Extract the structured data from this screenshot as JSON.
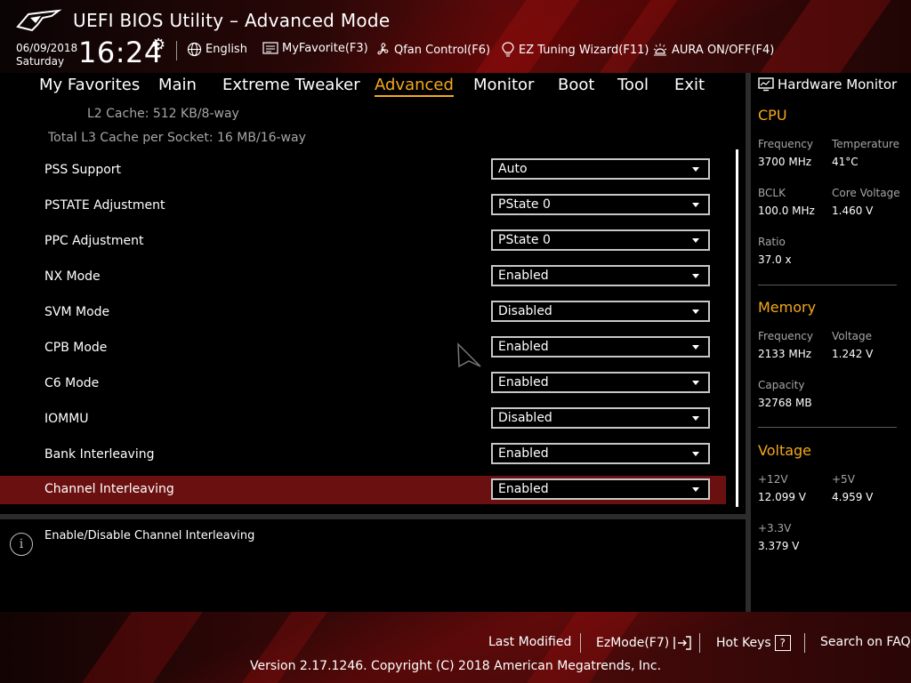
{
  "header": {
    "title": "UEFI BIOS Utility – Advanced Mode",
    "date": "06/09/2018",
    "day": "Saturday",
    "time": "16:24",
    "toolbar": {
      "language": "English",
      "favorite": "MyFavorite(F3)",
      "qfan": "Qfan Control(F6)",
      "ez_tuning": "EZ Tuning Wizard(F11)",
      "aura": "AURA ON/OFF(F4)"
    }
  },
  "nav": {
    "tabs": [
      {
        "label": "My Favorites"
      },
      {
        "label": "Main"
      },
      {
        "label": "Extreme Tweaker"
      },
      {
        "label": "Advanced"
      },
      {
        "label": "Monitor"
      },
      {
        "label": "Boot"
      },
      {
        "label": "Tool"
      },
      {
        "label": "Exit"
      }
    ],
    "active": "Advanced"
  },
  "main": {
    "info_lines": [
      "L2 Cache: 512 KB/8-way",
      "Total L3 Cache per Socket: 16 MB/16-way"
    ],
    "settings": [
      {
        "label": "PSS Support",
        "value": "Auto"
      },
      {
        "label": "PSTATE Adjustment",
        "value": "PState 0"
      },
      {
        "label": "PPC Adjustment",
        "value": "PState 0"
      },
      {
        "label": "NX Mode",
        "value": "Enabled"
      },
      {
        "label": "SVM Mode",
        "value": "Disabled"
      },
      {
        "label": "CPB Mode",
        "value": "Enabled"
      },
      {
        "label": "C6 Mode",
        "value": "Enabled"
      },
      {
        "label": "IOMMU",
        "value": "Disabled"
      },
      {
        "label": "Bank Interleaving",
        "value": "Enabled"
      },
      {
        "label": "Channel Interleaving",
        "value": "Enabled"
      }
    ],
    "selected_index": 9
  },
  "help": {
    "text": "Enable/Disable Channel Interleaving"
  },
  "hardware_monitor": {
    "title": "Hardware Monitor",
    "cpu": {
      "heading": "CPU",
      "frequency_label": "Frequency",
      "frequency": "3700 MHz",
      "temperature_label": "Temperature",
      "temperature": "41°C",
      "bclk_label": "BCLK",
      "bclk": "100.0 MHz",
      "core_voltage_label": "Core Voltage",
      "core_voltage": "1.460 V",
      "ratio_label": "Ratio",
      "ratio": "37.0 x"
    },
    "memory": {
      "heading": "Memory",
      "frequency_label": "Frequency",
      "frequency": "2133 MHz",
      "voltage_label": "Voltage",
      "voltage": "1.242 V",
      "capacity_label": "Capacity",
      "capacity": "32768 MB"
    },
    "voltage": {
      "heading": "Voltage",
      "v12_label": "+12V",
      "v12": "12.099 V",
      "v5_label": "+5V",
      "v5": "4.959 V",
      "v33_label": "+3.3V",
      "v33": "3.379 V"
    }
  },
  "footer": {
    "last_modified": "Last Modified",
    "ezmode": "EzMode(F7)",
    "hot_keys": "Hot Keys",
    "hot_keys_key": "?",
    "faq": "Search on FAQ",
    "copyright": "Version 2.17.1246. Copyright (C) 2018 American Megatrends, Inc."
  },
  "colors": {
    "accent": "#f5a81c",
    "selected_row": "#6b1010",
    "header_red": "#5a0a0a"
  }
}
